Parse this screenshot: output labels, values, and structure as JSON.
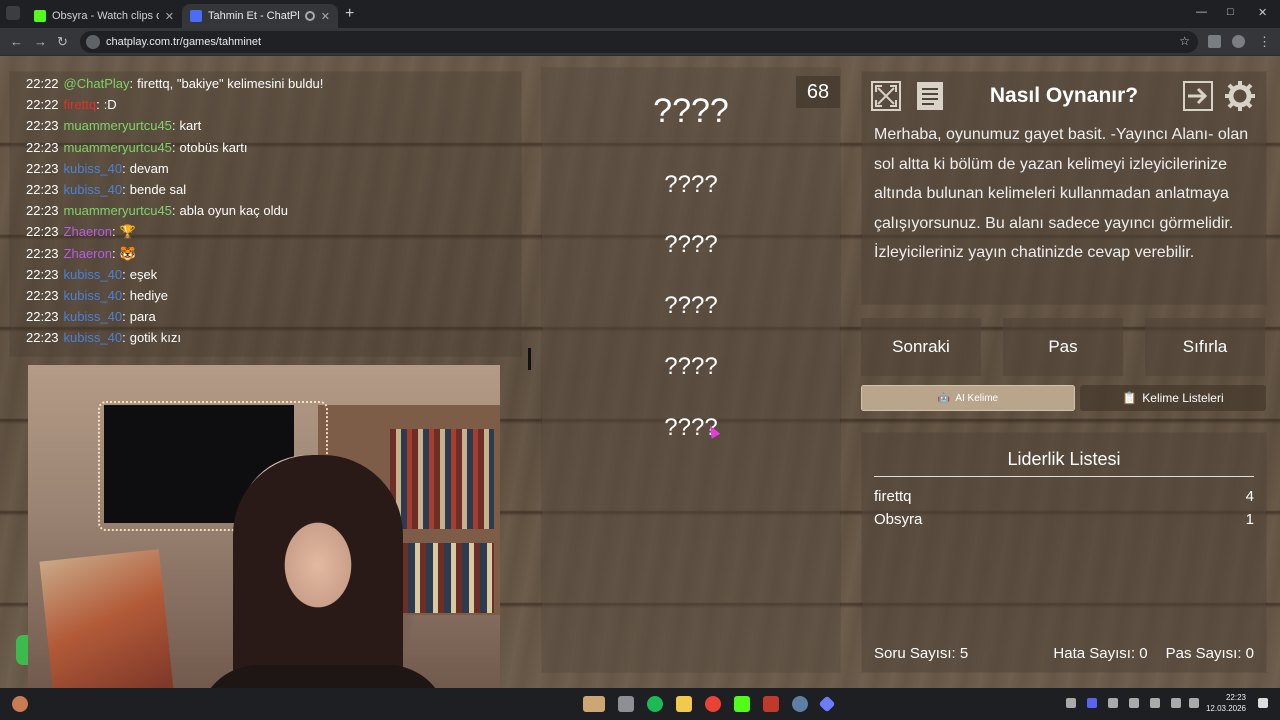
{
  "browser": {
    "tabs": [
      {
        "title": "Obsyra - Watch clips on Kick",
        "favicon_color": "#53fc18",
        "active": false
      },
      {
        "title": "Tahmin Et - ChatPlay",
        "favicon_color": "#4a6cf7",
        "active": true
      }
    ],
    "url": "chatplay.com.tr/games/tahminet"
  },
  "chat": {
    "lines": [
      {
        "time": "22:22",
        "user": "@ChatPlay",
        "user_color": "#7fd36a",
        "text": "firettq, \"bakiye\" kelimesini buldu!"
      },
      {
        "time": "22:22",
        "user": "firettq",
        "user_color": "#e0302a",
        "text": ":D"
      },
      {
        "time": "22:23",
        "user": "muammeryurtcu45",
        "user_color": "#7fd36a",
        "text": "kart"
      },
      {
        "time": "22:23",
        "user": "muammeryurtcu45",
        "user_color": "#7fd36a",
        "text": "otobüs kartı"
      },
      {
        "time": "22:23",
        "user": "kubiss_40",
        "user_color": "#4a82d6",
        "text": "devam"
      },
      {
        "time": "22:23",
        "user": "kubiss_40",
        "user_color": "#4a82d6",
        "text": "bende sal"
      },
      {
        "time": "22:23",
        "user": "muammeryurtcu45",
        "user_color": "#7fd36a",
        "text": "abla oyun kaç oldu"
      },
      {
        "time": "22:23",
        "user": "Zhaeron",
        "user_color": "#b45ee0",
        "text": "🏆"
      },
      {
        "time": "22:23",
        "user": "Zhaeron",
        "user_color": "#b45ee0",
        "text": "🐯"
      },
      {
        "time": "22:23",
        "user": "kubiss_40",
        "user_color": "#4a82d6",
        "text": "eşek"
      },
      {
        "time": "22:23",
        "user": "kubiss_40",
        "user_color": "#4a82d6",
        "text": "hediye"
      },
      {
        "time": "22:23",
        "user": "kubiss_40",
        "user_color": "#4a82d6",
        "text": "para"
      },
      {
        "time": "22:23",
        "user": "kubiss_40",
        "user_color": "#4a82d6",
        "text": "gotik kızı"
      }
    ]
  },
  "game": {
    "timer": "68",
    "main_word": "????",
    "forbidden_words": [
      "????",
      "????",
      "????",
      "????",
      "????"
    ]
  },
  "howto": {
    "title": "Nasıl Oynanır?",
    "text": "Merhaba, oyunumuz gayet basit. -Yayıncı Alanı- olan sol altta ki bölüm de yazan kelimeyi izleyicilerinize altında bulunan kelimeleri kullanmadan anlatmaya çalışıyorsunuz. Bu alanı sadece yayıncı görmelidir. İzleyicileriniz yayın chatinizde cevap verebilir."
  },
  "controls": {
    "next": "Sonraki",
    "pass": "Pas",
    "reset": "Sıfırla",
    "ai_word": "AI Kelime",
    "word_lists": "Kelime Listeleri"
  },
  "leaderboard": {
    "title": "Liderlik Listesi",
    "rows": [
      {
        "name": "firettq",
        "score": "4"
      },
      {
        "name": "Obsyra",
        "score": "1"
      }
    ],
    "question_count": "Soru Sayısı: 5",
    "error_count": "Hata Sayısı: 0",
    "pass_count": "Pas Sayısı: 0"
  },
  "taskbar": {
    "time": "22:23",
    "date": "12.03.2026"
  }
}
